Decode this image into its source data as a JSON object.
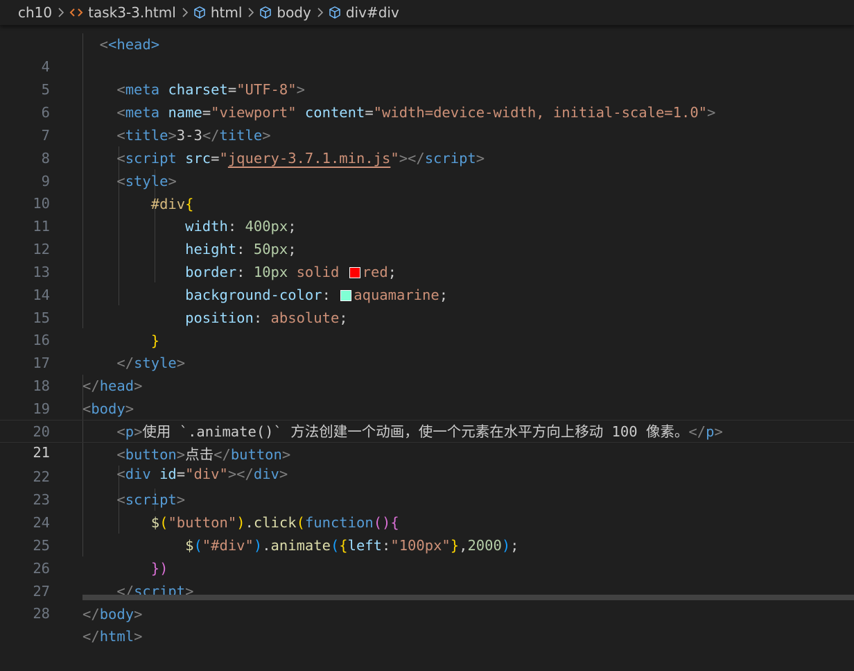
{
  "breadcrumb": {
    "folder": "ch10",
    "file": "task3-3.html",
    "html": "html",
    "body": "body",
    "div": "div#div"
  },
  "editor": {
    "current_line": 21,
    "line_numbers": [
      "4",
      "5",
      "6",
      "7",
      "8",
      "9",
      "10",
      "11",
      "12",
      "13",
      "14",
      "15",
      "16",
      "17",
      "18",
      "19",
      "20",
      "21",
      "22",
      "23",
      "24",
      "25",
      "26",
      "27",
      "28"
    ],
    "top_partial": "<head>",
    "colors": {
      "red_swatch": "#ff0000",
      "aquamarine_swatch": "#7fffd4"
    },
    "lines": {
      "l4": {
        "tag": "meta",
        "attr": "charset",
        "val": "\"UTF-8\""
      },
      "l5": {
        "tag": "meta",
        "attr1": "name",
        "val1": "\"viewport\"",
        "attr2": "content",
        "val2": "\"width=device-width, initial-scale=1.0\""
      },
      "l6": {
        "tag": "title",
        "text": "3-3"
      },
      "l7": {
        "tag": "script",
        "attr": "src",
        "val_pre": "\"",
        "val_link": "jquery-3.7.1.min.js",
        "val_post": "\""
      },
      "l8": {
        "tag": "style"
      },
      "l9": {
        "selector": "#div"
      },
      "l10": {
        "prop": "width",
        "value": "400px"
      },
      "l11": {
        "prop": "height",
        "value": "50px"
      },
      "l12": {
        "prop": "border",
        "value_num": "10px",
        "value_kw": "solid",
        "value_color": "red"
      },
      "l13": {
        "prop": "background-color",
        "value_color": "aquamarine"
      },
      "l14": {
        "prop": "position",
        "value": "absolute"
      },
      "l15": {
        "brace": "}"
      },
      "l16": {
        "tag": "style"
      },
      "l17": {
        "tag": "head"
      },
      "l18": {
        "tag": "body"
      },
      "l19": {
        "tag": "p",
        "text": "使用 `.animate()` 方法创建一个动画，使一个元素在水平方向上移动 100 像素。"
      },
      "l20": {
        "tag": "button",
        "text": "点击"
      },
      "l21": {
        "tag": "div",
        "attr": "id",
        "val": "\"div\""
      },
      "l22": {
        "tag": "script"
      },
      "l23": {
        "dollar": "$",
        "str": "\"button\"",
        "method": "click",
        "fn": "function"
      },
      "l24": {
        "dollar": "$",
        "str": "\"#div\"",
        "method": "animate",
        "key": "left",
        "str2": "\"100px\"",
        "num": "2000"
      },
      "l25": {
        "close": "})"
      },
      "l26": {
        "tag": "script"
      },
      "l27": {
        "tag": "body"
      },
      "l28": {
        "tag": "html"
      }
    }
  }
}
